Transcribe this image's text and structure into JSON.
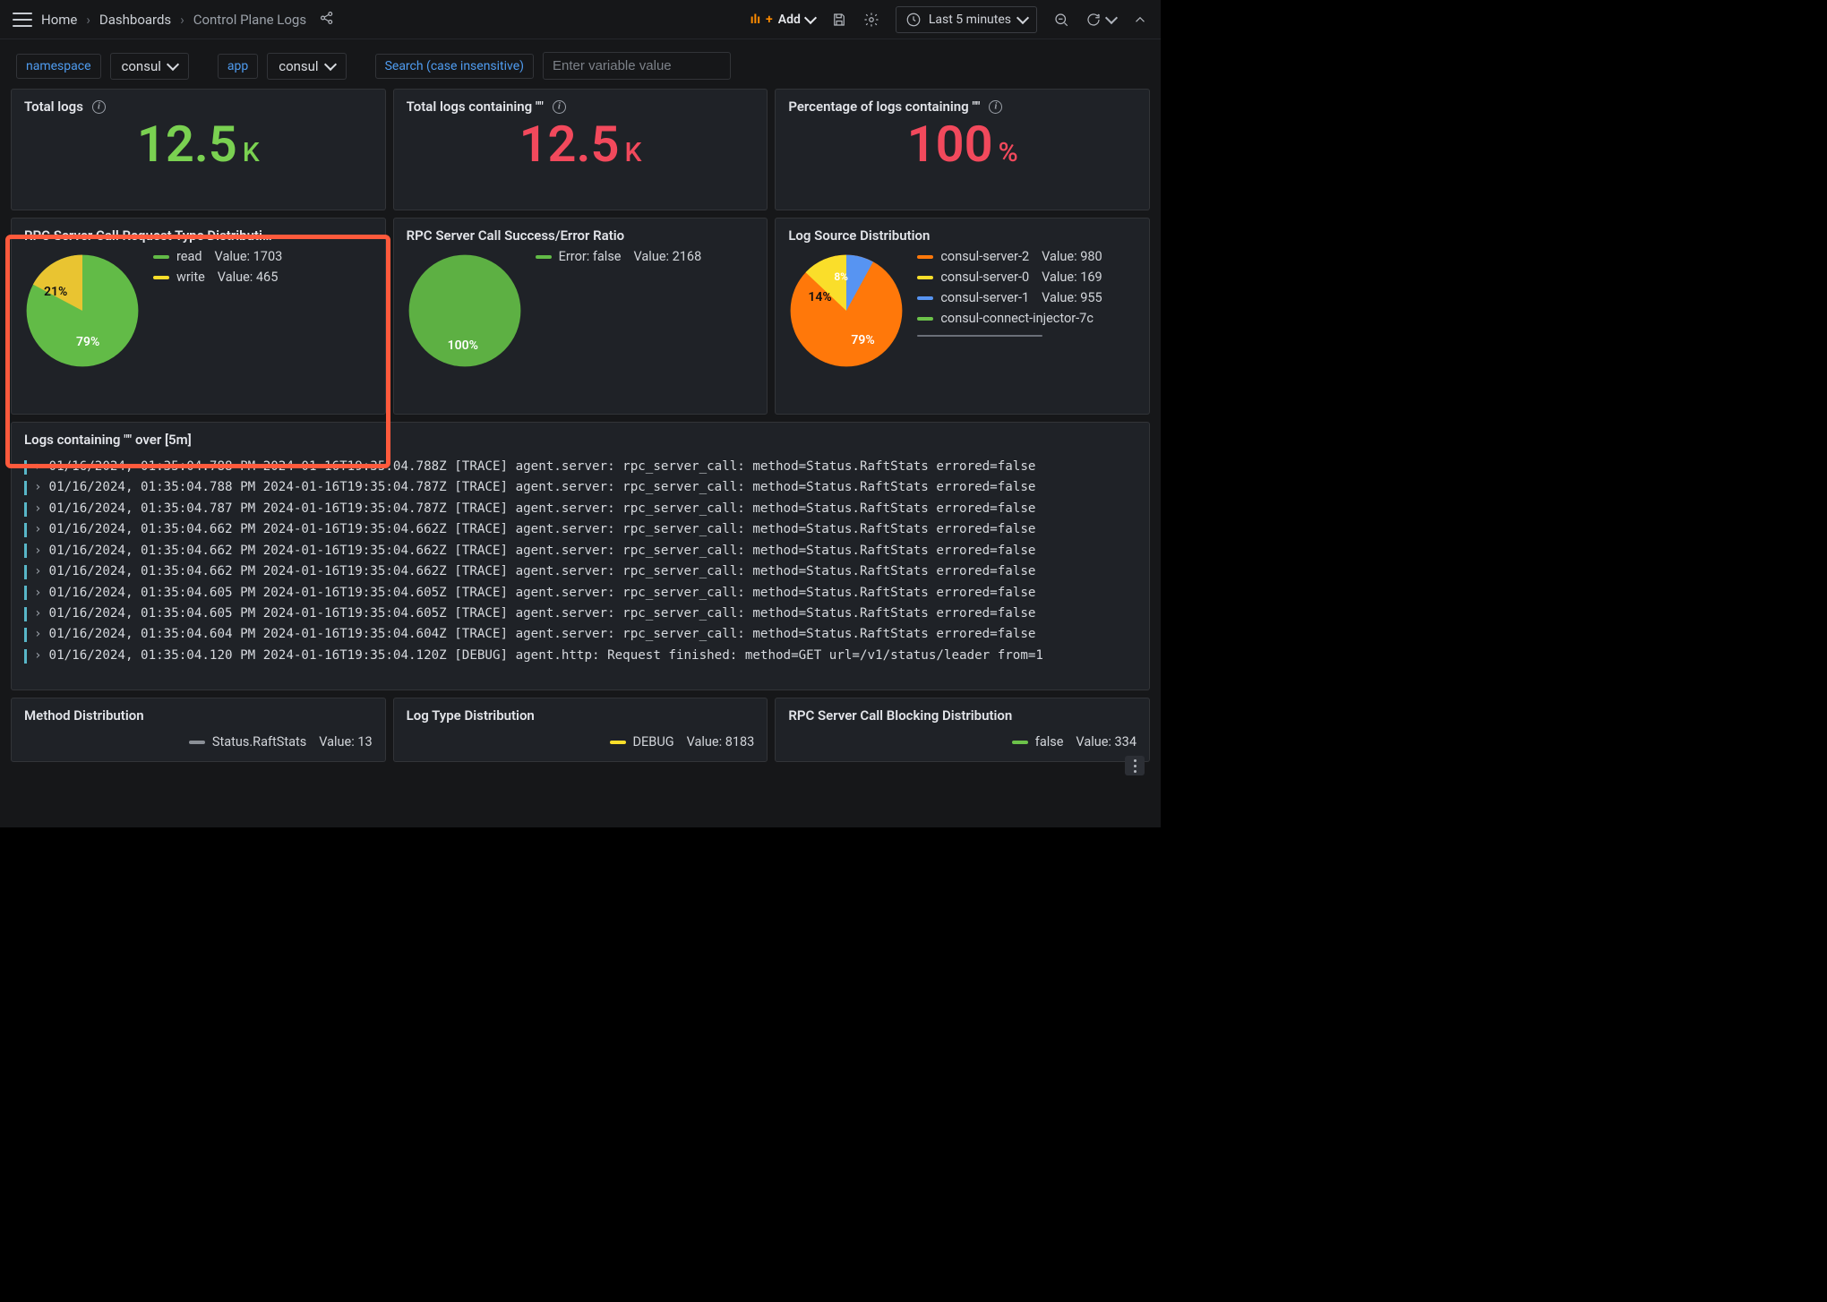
{
  "breadcrumbs": {
    "home": "Home",
    "dashboards": "Dashboards",
    "current": "Control Plane Logs"
  },
  "toolbar": {
    "add": "Add",
    "time": "Last 5 minutes"
  },
  "vars": {
    "namespace_label": "namespace",
    "namespace_value": "consul",
    "app_label": "app",
    "app_value": "consul",
    "search_label": "Search (case insensitive)",
    "search_placeholder": "Enter variable value"
  },
  "panels": {
    "total_logs": {
      "title": "Total logs",
      "value": "12.5",
      "unit": "K"
    },
    "total_containing": {
      "title": "Total logs containing \"\"",
      "value": "12.5",
      "unit": "K"
    },
    "percentage": {
      "title": "Percentage of logs containing \"\"",
      "value": "100",
      "unit": "%"
    },
    "rpc_req": {
      "title": "RPC Server Call Request Type Distributi…",
      "read_label": "read",
      "read_value": "Value: 1703",
      "write_label": "write",
      "write_value": "Value: 465",
      "pct_read": "79%",
      "pct_write": "21%"
    },
    "rpc_ratio": {
      "title": "RPC Server Call Success/Error Ratio",
      "err_label": "Error: false",
      "err_value": "Value: 2168",
      "pct": "100%"
    },
    "log_src": {
      "title": "Log Source Distribution",
      "s0_label": "consul-server-2",
      "s0_value": "Value: 980",
      "s1_label": "consul-server-0",
      "s1_value": "Value: 169",
      "s2_label": "consul-server-1",
      "s2_value": "Value: 955",
      "s3_label": "consul-connect-injector-7c",
      "pct_big": "79%",
      "pct_mid": "14%",
      "pct_small": "8%"
    },
    "logs_over": {
      "title": "Logs containing \"\" over [5m]"
    },
    "method_dist": {
      "title": "Method Distribution",
      "l0_label": "Status.RaftStats",
      "l0_value": "Value: 13"
    },
    "log_type_dist": {
      "title": "Log Type Distribution",
      "l0_label": "DEBUG",
      "l0_value": "Value: 8183"
    },
    "rpc_block": {
      "title": "RPC Server Call Blocking Distribution",
      "l0_label": "false",
      "l0_value": "Value: 334"
    }
  },
  "log_lines": [
    "01/16/2024, 01:35:04.788 PM 2024-01-16T19:35:04.788Z [TRACE] agent.server: rpc_server_call: method=Status.RaftStats errored=false",
    "01/16/2024, 01:35:04.788 PM 2024-01-16T19:35:04.787Z [TRACE] agent.server: rpc_server_call: method=Status.RaftStats errored=false",
    "01/16/2024, 01:35:04.787 PM 2024-01-16T19:35:04.787Z [TRACE] agent.server: rpc_server_call: method=Status.RaftStats errored=false",
    "01/16/2024, 01:35:04.662 PM 2024-01-16T19:35:04.662Z [TRACE] agent.server: rpc_server_call: method=Status.RaftStats errored=false",
    "01/16/2024, 01:35:04.662 PM 2024-01-16T19:35:04.662Z [TRACE] agent.server: rpc_server_call: method=Status.RaftStats errored=false",
    "01/16/2024, 01:35:04.662 PM 2024-01-16T19:35:04.662Z [TRACE] agent.server: rpc_server_call: method=Status.RaftStats errored=false",
    "01/16/2024, 01:35:04.605 PM 2024-01-16T19:35:04.605Z [TRACE] agent.server: rpc_server_call: method=Status.RaftStats errored=false",
    "01/16/2024, 01:35:04.605 PM 2024-01-16T19:35:04.605Z [TRACE] agent.server: rpc_server_call: method=Status.RaftStats errored=false",
    "01/16/2024, 01:35:04.604 PM 2024-01-16T19:35:04.604Z [TRACE] agent.server: rpc_server_call: method=Status.RaftStats errored=false",
    "01/16/2024, 01:35:04.120 PM 2024-01-16T19:35:04.120Z [DEBUG] agent.http: Request finished: method=GET url=/v1/status/leader from=1"
  ],
  "chart_data": [
    {
      "type": "pie",
      "title": "RPC Server Call Request Type Distribution",
      "series": [
        {
          "name": "read",
          "value": 1703,
          "pct": 79,
          "color": "#62bb47"
        },
        {
          "name": "write",
          "value": 465,
          "pct": 21,
          "color": "#e9c431"
        }
      ]
    },
    {
      "type": "pie",
      "title": "RPC Server Call Success/Error Ratio",
      "series": [
        {
          "name": "Error: false",
          "value": 2168,
          "pct": 100,
          "color": "#62bb47"
        }
      ]
    },
    {
      "type": "pie",
      "title": "Log Source Distribution",
      "series": [
        {
          "name": "consul-server-2",
          "value": 980,
          "pct": 79,
          "color": "#ff780a"
        },
        {
          "name": "consul-server-0",
          "value": 169,
          "pct": 14,
          "color": "#fade2a"
        },
        {
          "name": "consul-server-1",
          "value": 955,
          "pct": 8,
          "color": "#5794f2"
        },
        {
          "name": "consul-connect-injector-7c",
          "value": null,
          "pct": 0,
          "color": "#6cc24a"
        }
      ]
    }
  ]
}
